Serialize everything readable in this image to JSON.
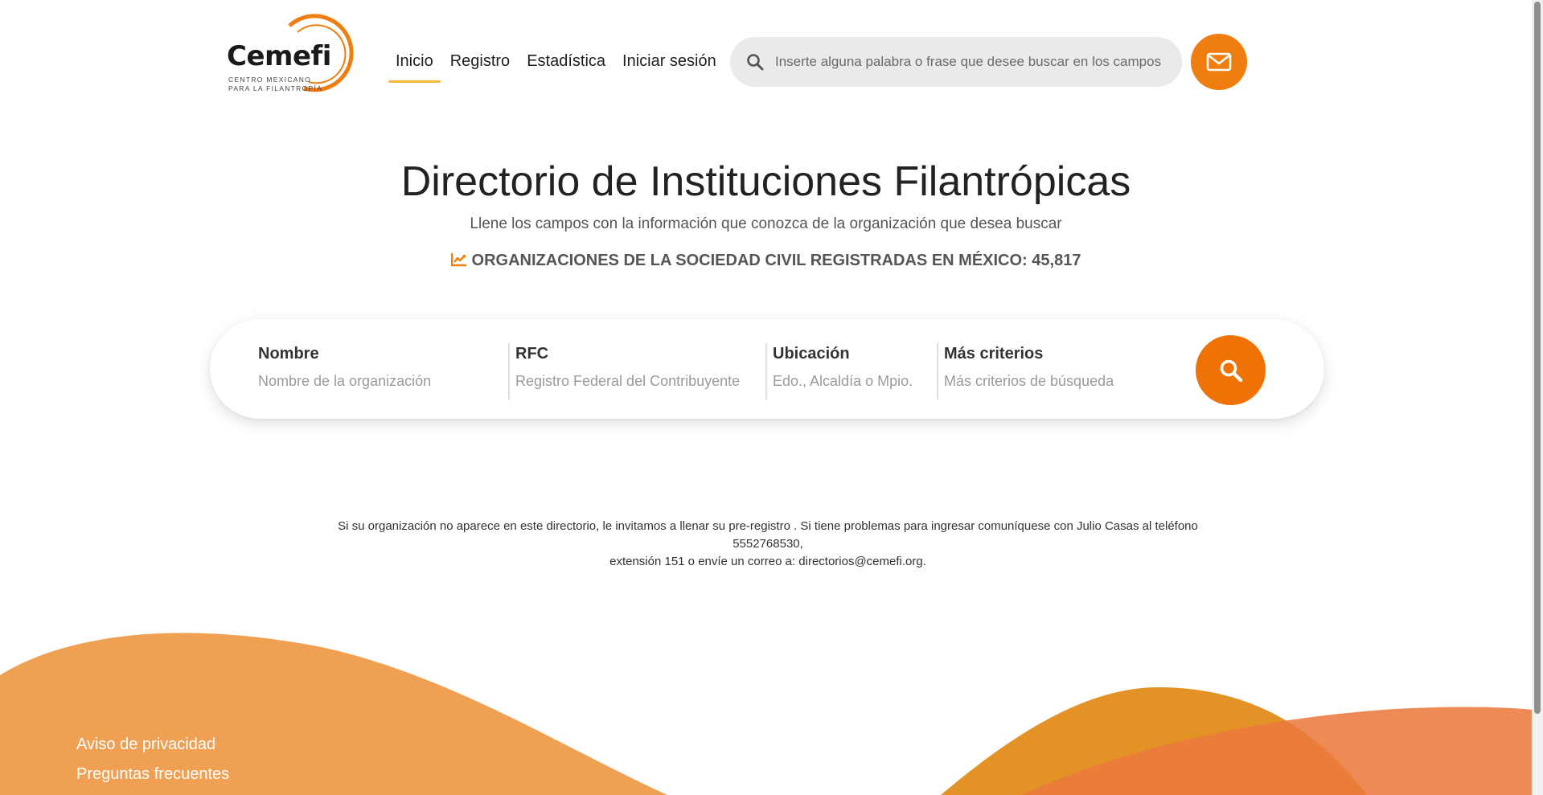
{
  "header": {
    "logo": {
      "word": "Cemefi",
      "sub_line1": "CENTRO MEXICANO",
      "sub_line2": "PARA LA FILANTROPÍA"
    },
    "nav": [
      {
        "label": "Inicio",
        "active": true
      },
      {
        "label": "Registro",
        "active": false
      },
      {
        "label": "Estadística",
        "active": false
      },
      {
        "label": "Iniciar sesión",
        "active": false
      }
    ],
    "search": {
      "placeholder": "Inserte alguna palabra o frase que desee buscar en los campos",
      "icon": "search-icon"
    },
    "mail_button": {
      "icon": "envelope-icon"
    }
  },
  "hero": {
    "title": "Directorio de Instituciones Filantrópicas",
    "subtitle": "Llene los campos con la información que conozca de la organización que desea buscar",
    "stats_icon": "chart-line-icon",
    "stats_text": "ORGANIZACIONES DE LA SOCIEDAD CIVIL REGISTRADAS EN MÉXICO: 45,817"
  },
  "search_card": {
    "fields": [
      {
        "label": "Nombre",
        "placeholder": "Nombre de la organización"
      },
      {
        "label": "RFC",
        "placeholder": "Registro Federal del Contribuyente"
      },
      {
        "label": "Ubicación",
        "placeholder": "Edo., Alcaldía o Mpio."
      },
      {
        "label": "Más criterios",
        "placeholder": "Más criterios de búsqueda"
      }
    ],
    "button_icon": "search-icon"
  },
  "info": {
    "line1": "Si su organización no aparece en este directorio, le invitamos a llenar su pre-registro . Si tiene problemas para ingresar comuníquese con Julio Casas al teléfono 5552768530,",
    "line2": "extensión 151 o envíe un correo a: directorios@cemefi.org."
  },
  "footer": {
    "links": [
      "Aviso de privacidad",
      "Preguntas frecuentes"
    ]
  },
  "colors": {
    "accent": "#ef7d0f",
    "nav_underline": "#f5b93f",
    "wave_left": "#f0a052",
    "wave_right_a": "#e28c1a",
    "wave_right_b": "#ec7c40"
  }
}
